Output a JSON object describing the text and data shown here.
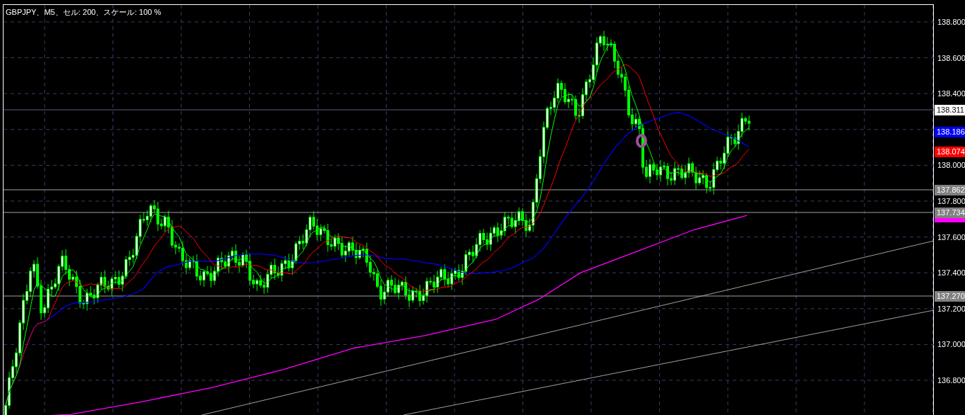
{
  "chart": {
    "title": "GBPJPY、M5、セル: 200、スケール: 100 %"
  },
  "price_axis": {
    "ticks": [
      "138.800",
      "138.600",
      "138.400",
      "138.000",
      "137.800",
      "137.600",
      "137.400",
      "137.200",
      "137.000",
      "136.800"
    ]
  },
  "price_tags": [
    {
      "label": "138.311",
      "color": "#ffffff",
      "kind": "line"
    },
    {
      "label": "138.186",
      "color": "#0000ff",
      "kind": "indicator"
    },
    {
      "label": "138.074",
      "color": "#ff0000",
      "kind": "indicator"
    },
    {
      "label": "137.862",
      "color": "#808080",
      "kind": "line"
    },
    {
      "label": "137.734",
      "color": "#808080",
      "kind": "line"
    },
    {
      "label": "137.270",
      "color": "#808080",
      "kind": "line"
    }
  ]
}
